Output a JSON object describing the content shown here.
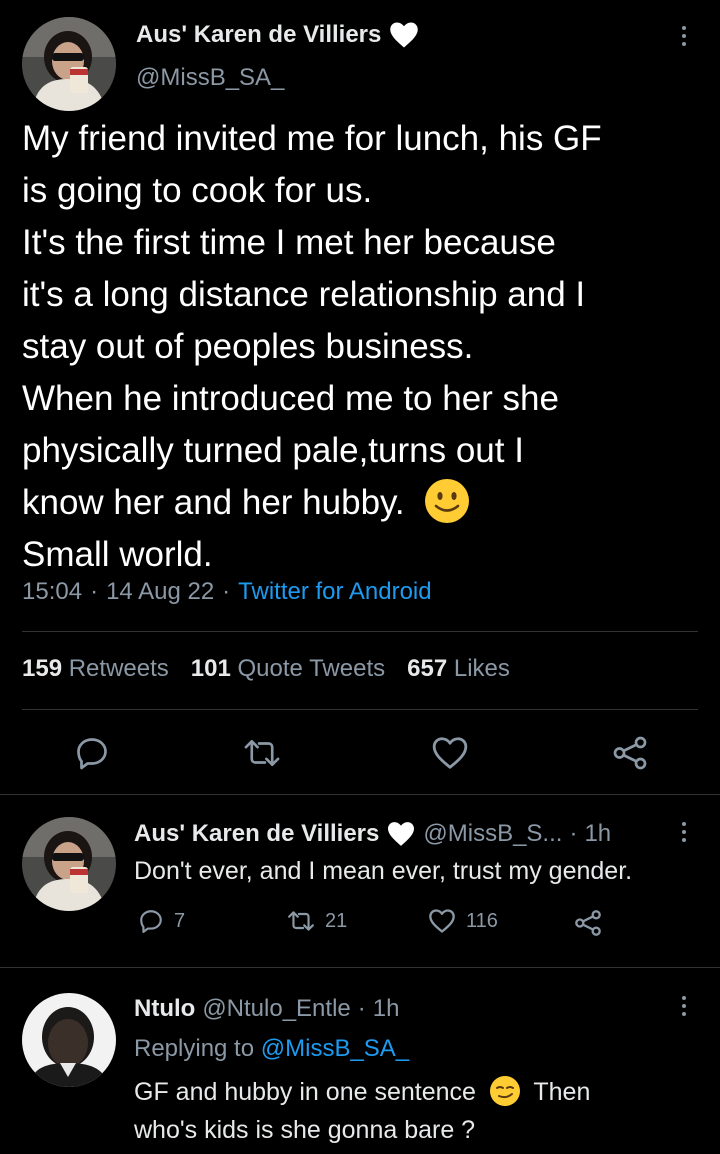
{
  "main_tweet": {
    "display_name": "Aus' Karen de Villiers",
    "handle": "@MissB_SA_",
    "text_lines": [
      "My friend invited me for lunch, his GF",
      "is going to cook for us.",
      "It's the first time I met her because",
      "it's a long distance relationship and I",
      "stay out of peoples business.",
      "When he introduced me to her she",
      "physically turned pale,turns out I",
      "know her and her hubby.",
      "Small world."
    ],
    "time": "15:04",
    "sep1": "·",
    "date": "14 Aug 22",
    "sep2": "·",
    "source": "Twitter for Android",
    "stats": {
      "retweets_count": "159",
      "retweets_label": "Retweets",
      "quotes_count": "101",
      "quotes_label": "Quote Tweets",
      "likes_count": "657",
      "likes_label": "Likes"
    }
  },
  "reply1": {
    "display_name": "Aus' Karen de Villiers",
    "handle": "@MissB_S...",
    "sep": "·",
    "time": "1h",
    "text": "Don't ever, and I mean ever, trust my gender.",
    "reply_count": "7",
    "retweet_count": "21",
    "like_count": "116"
  },
  "reply2": {
    "display_name": "Ntulo",
    "handle": "@Ntulo_Entle",
    "sep": "·",
    "time": "1h",
    "replying_prefix": "Replying to",
    "replying_to": "@MissB_SA_",
    "text_line1": "GF and hubby in one sentence",
    "text_line1b": "Then",
    "text_line2": "who's kids is she gonna bare ?"
  },
  "colors": {
    "accent": "#1d9bf0",
    "muted": "#8b98a5",
    "divider": "#2f3336",
    "background": "#000000"
  }
}
